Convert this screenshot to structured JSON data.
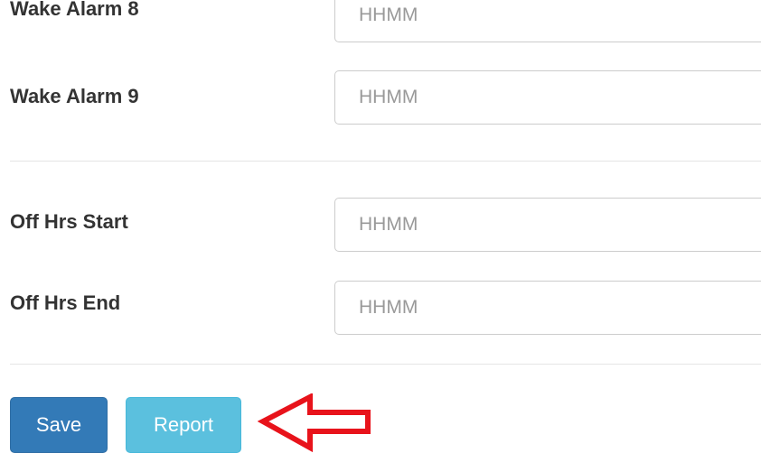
{
  "form": {
    "fields": [
      {
        "label": "Wake Alarm 8",
        "placeholder": "HHMM",
        "value": ""
      },
      {
        "label": "Wake Alarm 9",
        "placeholder": "HHMM",
        "value": ""
      },
      {
        "label": "Off Hrs Start",
        "placeholder": "HHMM",
        "value": ""
      },
      {
        "label": "Off Hrs End",
        "placeholder": "HHMM",
        "value": ""
      }
    ]
  },
  "actions": {
    "save_label": "Save",
    "report_label": "Report"
  },
  "colors": {
    "save_button": "#337ab7",
    "report_button": "#5bc0de",
    "annotation_arrow": "#e8131b"
  },
  "annotation": {
    "icon": "left-arrow-outline-icon"
  }
}
